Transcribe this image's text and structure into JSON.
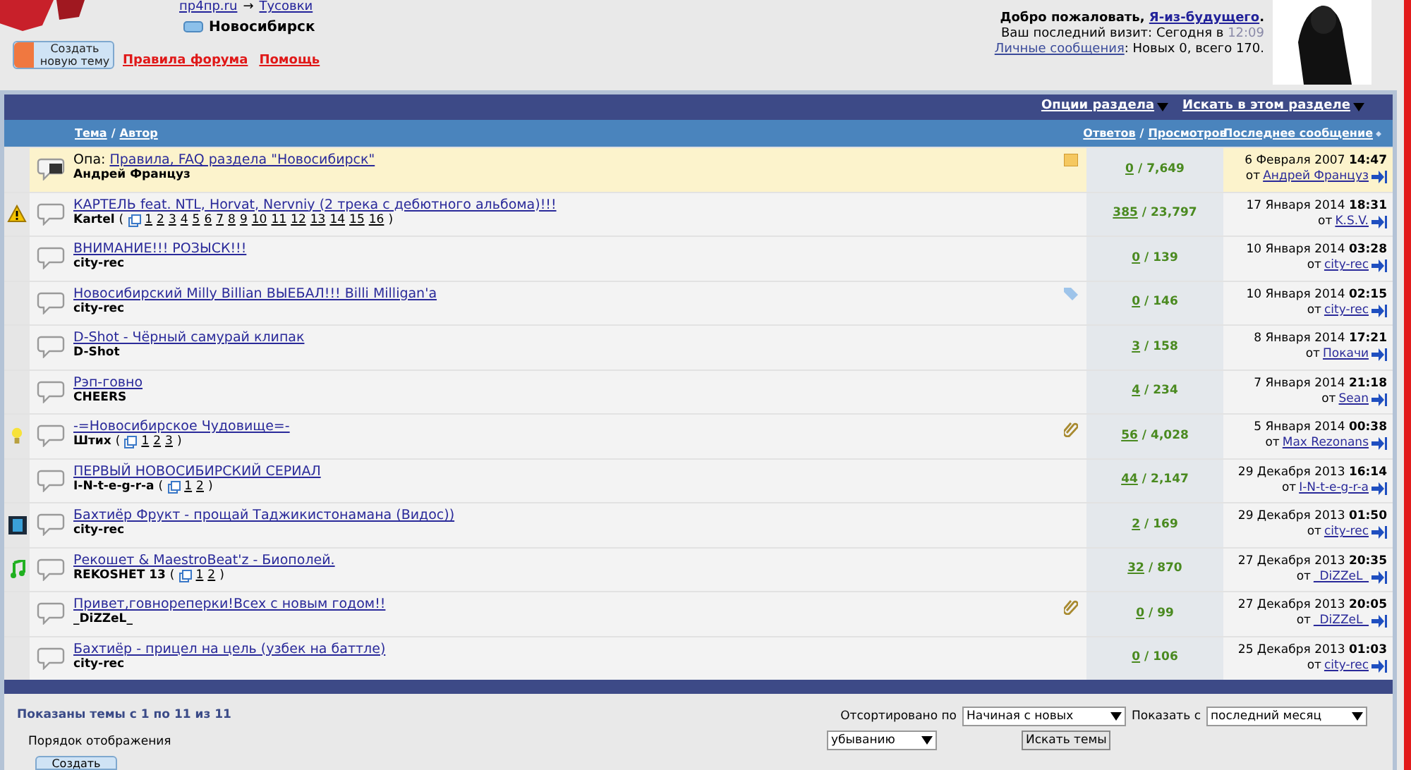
{
  "header": {
    "breadcrumb": [
      "пр4пр.ru",
      "Тусовки"
    ],
    "breadcrumb_arrow": "→",
    "current": "Новосибирск",
    "new_topic_button": [
      "Создать",
      "новую тему"
    ],
    "links": [
      "Правила форума",
      "Помощь"
    ],
    "welcome": {
      "prefix": "Добро пожаловать, ",
      "user": "Я-из-будущего",
      "suffix": "."
    },
    "last_visit": {
      "label": "Ваш последний визит: Сегодня в ",
      "time": "12:09"
    },
    "messages": {
      "link": "Личные сообщения",
      "text": ": Новых 0, всего 170."
    }
  },
  "toolbar": [
    "Опции раздела",
    "Искать в этом разделе"
  ],
  "columns": {
    "thread": [
      "Тема",
      "/",
      "Автор"
    ],
    "counts": [
      "Ответов",
      "/",
      "Просмотров"
    ],
    "last": "Последнее сообщение"
  },
  "rows": [
    {
      "sticky": true,
      "locked": true,
      "side": {
        "kind": "note"
      },
      "prefix": "Опа:",
      "title": "Правила, FAQ раздела \"Новосибирск\"",
      "author": "Андрей Француз",
      "replies": "0",
      "slash": "/",
      "views": "7,649",
      "date": "6 Февраля 2007",
      "time": "14:47",
      "by_label": "от",
      "by": "Андрей Француз"
    },
    {
      "sticky": false,
      "locked": false,
      "status": {
        "kind": "warning"
      },
      "title": "КАРТЕЛЬ feat. NTL, Horvat, Nervniy (2 трека с дебютного альбома)!!!",
      "author": "Kartel",
      "pages": {
        "open": "(",
        "items": [
          "1",
          "2",
          "3",
          "4",
          "5",
          "6",
          "7",
          "8",
          "9",
          "10",
          "11",
          "12",
          "13",
          "14",
          "15",
          "16"
        ],
        "close": ")"
      },
      "replies": "385",
      "slash": "/",
      "views": "23,797",
      "date": "17 Января 2014",
      "time": "18:31",
      "by_label": "от",
      "by": "K.S.V."
    },
    {
      "sticky": false,
      "locked": false,
      "title": "ВНИМАНИЕ!!! РОЗЫСК!!!",
      "author": "city-rec",
      "replies": "0",
      "slash": "/",
      "views": "139",
      "date": "10 Января 2014",
      "time": "03:28",
      "by_label": "от",
      "by": "city-rec"
    },
    {
      "sticky": false,
      "locked": false,
      "side": {
        "kind": "tag"
      },
      "title": "Новосибирский Milly Billian ВЫЕБАЛ!!! Billi Milligan'a",
      "author": "city-rec",
      "replies": "0",
      "slash": "/",
      "views": "146",
      "date": "10 Января 2014",
      "time": "02:15",
      "by_label": "от",
      "by": "city-rec"
    },
    {
      "sticky": false,
      "locked": false,
      "title": "D-Shot - Чёрный самурай клипак",
      "author": "D-Shot",
      "replies": "3",
      "slash": "/",
      "views": "158",
      "date": "8 Января 2014",
      "time": "17:21",
      "by_label": "от",
      "by": "Покачи"
    },
    {
      "sticky": false,
      "locked": false,
      "title": "Рэп-говно",
      "author": "CHEERS",
      "replies": "4",
      "slash": "/",
      "views": "234",
      "date": "7 Января 2014",
      "time": "21:18",
      "by_label": "от",
      "by": "Sean"
    },
    {
      "sticky": false,
      "locked": false,
      "status": {
        "kind": "bulb"
      },
      "side": {
        "kind": "clip"
      },
      "title": "-=Новосибирское Чудовище=-",
      "author": "Штих",
      "pages": {
        "open": "(",
        "items": [
          "1",
          "2",
          "3"
        ],
        "close": ")"
      },
      "replies": "56",
      "slash": "/",
      "views": "4,028",
      "date": "5 Января 2014",
      "time": "00:38",
      "by_label": "от",
      "by": "Max Rezonans"
    },
    {
      "sticky": false,
      "locked": false,
      "title": "ПЕРВЫЙ НОВОСИБИРСКИЙ СЕРИАЛ",
      "author": "I-N-t-e-g-r-a",
      "pages": {
        "open": "(",
        "items": [
          "1",
          "2"
        ],
        "close": ")"
      },
      "replies": "44",
      "slash": "/",
      "views": "2,147",
      "date": "29 Декабря 2013",
      "time": "16:14",
      "by_label": "от",
      "by": "I-N-t-e-g-r-a"
    },
    {
      "sticky": false,
      "locked": false,
      "status": {
        "kind": "film"
      },
      "title": "Бахтиёр Фрукт - прощай Таджикистонамана (Видос))",
      "author": "city-rec",
      "replies": "2",
      "slash": "/",
      "views": "169",
      "date": "29 Декабря 2013",
      "time": "01:50",
      "by_label": "от",
      "by": "city-rec"
    },
    {
      "sticky": false,
      "locked": false,
      "status": {
        "kind": "music"
      },
      "title": "Рекошет & MaestroBeat'z - Биополей.",
      "author": "REKOSHET 13",
      "pages": {
        "open": "(",
        "items": [
          "1",
          "2"
        ],
        "close": ")"
      },
      "replies": "32",
      "slash": "/",
      "views": "870",
      "date": "27 Декабря 2013",
      "time": "20:35",
      "by_label": "от",
      "by": "_DiZZeL_"
    },
    {
      "sticky": false,
      "locked": false,
      "side": {
        "kind": "clip"
      },
      "title": "Привет,говнореперки!Всех с новым годом!!",
      "author": "_DiZZeL_",
      "replies": "0",
      "slash": "/",
      "views": "99",
      "date": "27 Декабря 2013",
      "time": "20:05",
      "by_label": "от",
      "by": "_DiZZeL_"
    },
    {
      "sticky": false,
      "locked": false,
      "title": "Бахтиёр - прицел на цель (узбек на баттле)",
      "author": "city-rec",
      "replies": "0",
      "slash": "/",
      "views": "106",
      "date": "25 Декабря 2013",
      "time": "01:03",
      "by_label": "от",
      "by": "city-rec"
    }
  ],
  "footer": {
    "shown": "Показаны темы с 1 по 11 из 11",
    "order_label": "Порядок отображения",
    "sort_label": "Отсортировано по",
    "sort_value": "Начиная с новых",
    "show_label": "Показать с",
    "show_value": "последний месяц",
    "order_value": "убыванию",
    "search_button": "Искать темы",
    "new_topic_button": "Создать"
  }
}
